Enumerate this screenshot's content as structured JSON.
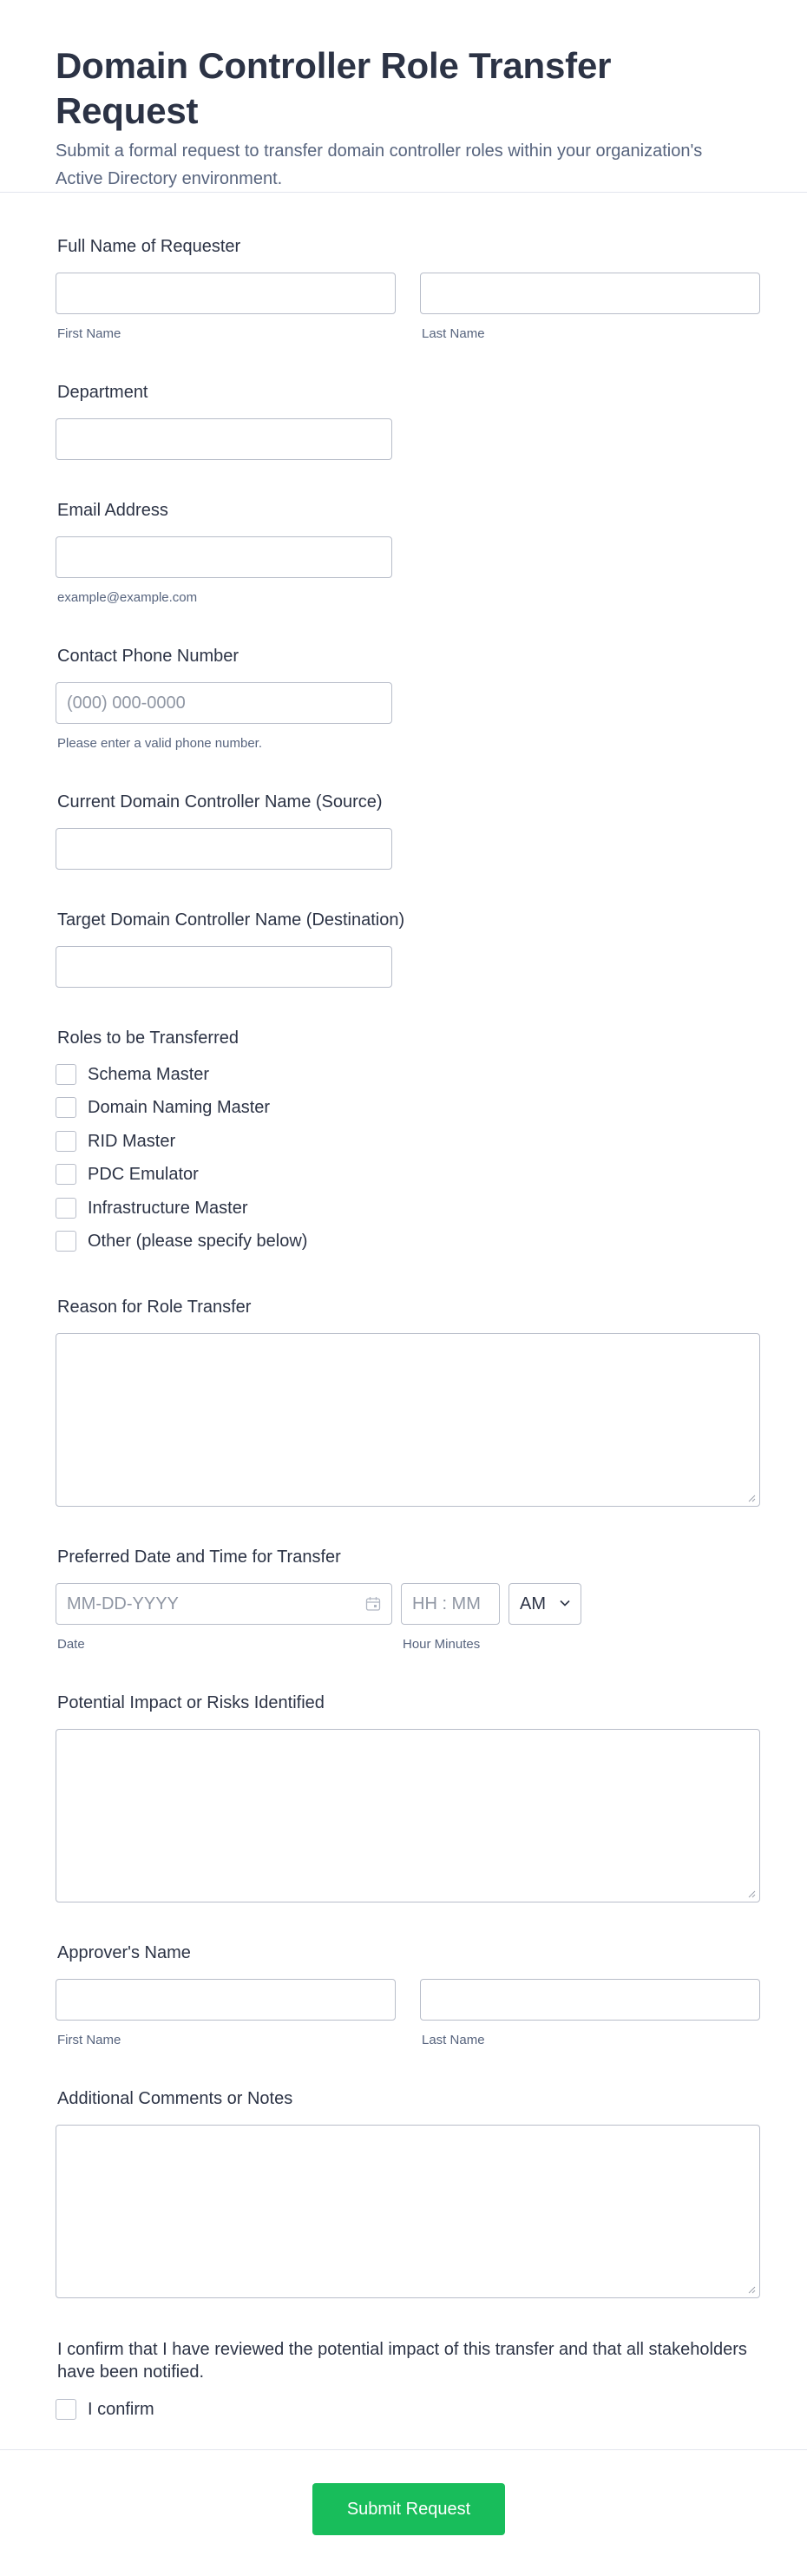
{
  "header": {
    "title": "Domain Controller Role Transfer Request",
    "subtitle": "Submit a formal request to transfer domain controller roles within your organization's Active Directory environment."
  },
  "requester": {
    "label": "Full Name of Requester",
    "first_sublabel": "First Name",
    "last_sublabel": "Last Name",
    "first_value": "",
    "last_value": ""
  },
  "department": {
    "label": "Department",
    "value": ""
  },
  "email": {
    "label": "Email Address",
    "value": "",
    "sublabel": "example@example.com"
  },
  "phone": {
    "label": "Contact Phone Number",
    "placeholder": "(000) 000-0000",
    "sublabel": "Please enter a valid phone number."
  },
  "source_dc": {
    "label": "Current Domain Controller Name (Source)",
    "value": ""
  },
  "target_dc": {
    "label": "Target Domain Controller Name (Destination)",
    "value": ""
  },
  "roles": {
    "label": "Roles to be Transferred",
    "options": [
      "Schema Master",
      "Domain Naming Master",
      "RID Master",
      "PDC Emulator",
      "Infrastructure Master",
      "Other (please specify below)"
    ]
  },
  "reason": {
    "label": "Reason for Role Transfer",
    "value": ""
  },
  "datetime": {
    "label": "Preferred Date and Time for Transfer",
    "date_placeholder": "MM-DD-YYYY",
    "time_placeholder": "HH : MM",
    "ampm_value": "AM",
    "date_sublabel": "Date",
    "time_sublabel": "Hour Minutes"
  },
  "impact": {
    "label": "Potential Impact or Risks Identified",
    "value": ""
  },
  "approver": {
    "label": "Approver's Name",
    "first_sublabel": "First Name",
    "last_sublabel": "Last Name"
  },
  "comments": {
    "label": "Additional Comments or Notes",
    "value": ""
  },
  "confirm": {
    "label": "I confirm that I have reviewed the potential impact of this transfer and that all stakeholders have been notified.",
    "option": "I confirm"
  },
  "submit_label": "Submit Request",
  "colors": {
    "accent": "#18bd5b",
    "border": "#b8bdc9",
    "text": "#2c3345",
    "muted": "#57647e"
  }
}
